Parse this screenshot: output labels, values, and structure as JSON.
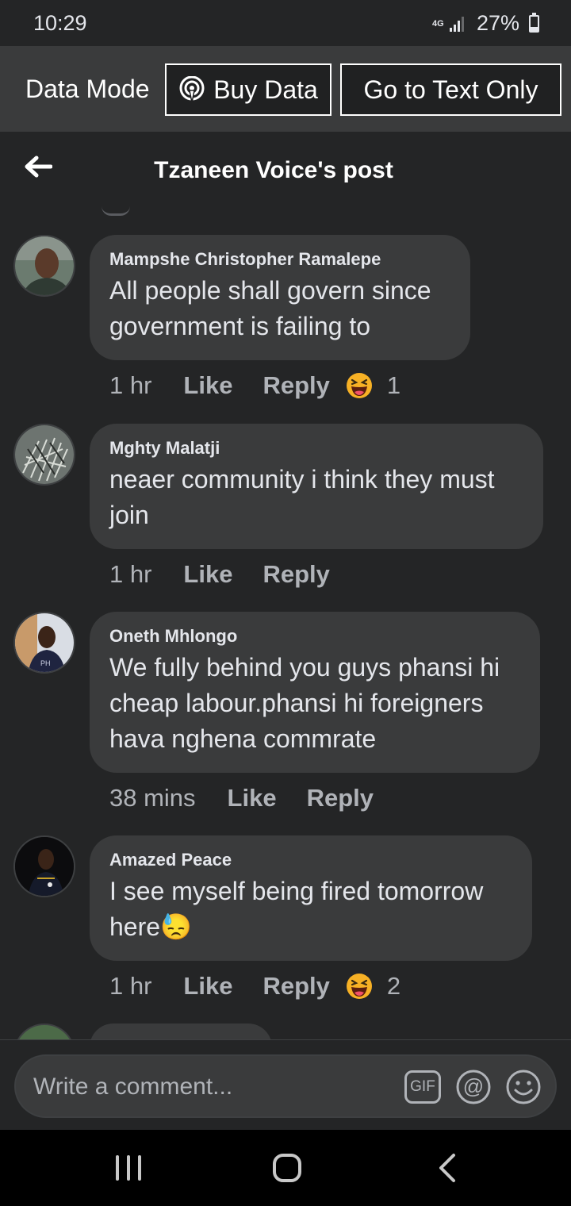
{
  "status_bar": {
    "time": "10:29",
    "network": "4G",
    "battery": "27%",
    "battery_level": 0.27
  },
  "data_mode_bar": {
    "label": "Data Mode",
    "buy_data": "Buy Data",
    "text_only": "Go to Text Only"
  },
  "header": {
    "title": "Tzaneen Voice's post",
    "back_icon": "arrow-left-icon"
  },
  "comments": [
    {
      "author": "Mampshe Christopher Ramalepe",
      "text": "All people shall govern since government is failing to",
      "time": "1 hr",
      "like": "Like",
      "reply": "Reply",
      "reaction_count": "1",
      "reaction_icon": "haha-icon"
    },
    {
      "author": "Mghty Malatji",
      "text": "neaer community i think they must join",
      "time": "1 hr",
      "like": "Like",
      "reply": "Reply"
    },
    {
      "author": "Oneth Mhlongo",
      "text": "We fully behind you guys phansi hi cheap labour.phansi hi foreigners hava nghena commrate",
      "time": "38 mins",
      "like": "Like",
      "reply": "Reply"
    },
    {
      "author": "Amazed Peace",
      "text": "I see myself being fired tomorrow here😓",
      "time": "1 hr",
      "like": "Like",
      "reply": "Reply",
      "reaction_count": "2",
      "reaction_icon": "haha-icon"
    }
  ],
  "composer": {
    "placeholder": "Write a comment...",
    "gif_label": "GIF"
  },
  "colors": {
    "background": "#242526",
    "bubble": "#3a3b3c",
    "text": "#e4e6eb",
    "muted": "#b0b3b8",
    "haha": "#f7b125"
  }
}
